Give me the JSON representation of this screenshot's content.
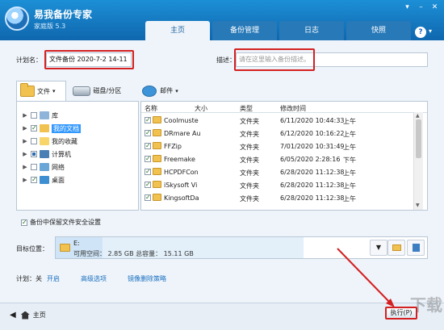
{
  "app": {
    "title": "易我备份专家",
    "subtitle": "家庭版 5.3"
  },
  "window_buttons": [
    "▾",
    "–",
    "✕"
  ],
  "tabs": [
    "主页",
    "备份管理",
    "日志",
    "快照"
  ],
  "help": "?",
  "plan": {
    "name_label": "计划名：",
    "name_value": "文件备份 2020-7-2 14-11",
    "desc_label": "描述：",
    "desc_placeholder": "请在这里输入备份描述。"
  },
  "source_tabs": [
    "文件",
    "磁盘/分区",
    "邮件"
  ],
  "tree": [
    {
      "label": "库",
      "icon": "library-icon"
    },
    {
      "label": "我的文档",
      "icon": "documents-folder-icon",
      "selected": true
    },
    {
      "label": "我的收藏",
      "icon": "favorites-icon"
    },
    {
      "label": "计算机",
      "icon": "computer-icon"
    },
    {
      "label": "网络",
      "icon": "network-icon"
    },
    {
      "label": "桌面",
      "icon": "desktop-icon"
    }
  ],
  "list": {
    "headers": [
      "名称",
      "大小",
      "类型",
      "修改时间"
    ],
    "rows": [
      {
        "name": "Coolmuste",
        "size": "",
        "type": "文件夹",
        "date": "6/11/2020 10:44:33",
        "ampm": "上午"
      },
      {
        "name": "DRmare Au",
        "size": "",
        "type": "文件夹",
        "date": "6/12/2020 10:16:22",
        "ampm": "上午"
      },
      {
        "name": "FFZip",
        "size": "",
        "type": "文件夹",
        "date": "7/01/2020 10:31:49",
        "ampm": "上午"
      },
      {
        "name": "Freemake",
        "size": "",
        "type": "文件夹",
        "date": "6/05/2020 2:28:16",
        "ampm": "下午"
      },
      {
        "name": "HCPDFCon",
        "size": "",
        "type": "文件夹",
        "date": "6/28/2020 11:12:38",
        "ampm": "上午"
      },
      {
        "name": "iSkysoft Vi",
        "size": "",
        "type": "文件夹",
        "date": "6/28/2020 11:12:38",
        "ampm": "上午"
      },
      {
        "name": "KingsoftDa",
        "size": "",
        "type": "文件夹",
        "date": "6/28/2020 11:12:38",
        "ampm": "上午"
      }
    ]
  },
  "safe_setting": "备份中保留文件安全设置",
  "target": {
    "label": "目标位置：",
    "drive": "E:",
    "info": "可用空间： 2.85 GB    总容量： 15.11 GB",
    "free_fraction": 0.189
  },
  "schedule": {
    "label": "计划：关",
    "open": "开启",
    "advanced": "高级选项",
    "mirror": "镜像删除策略"
  },
  "footer": {
    "home": "主页",
    "execute": "执行(P)"
  },
  "watermark": "下载"
}
